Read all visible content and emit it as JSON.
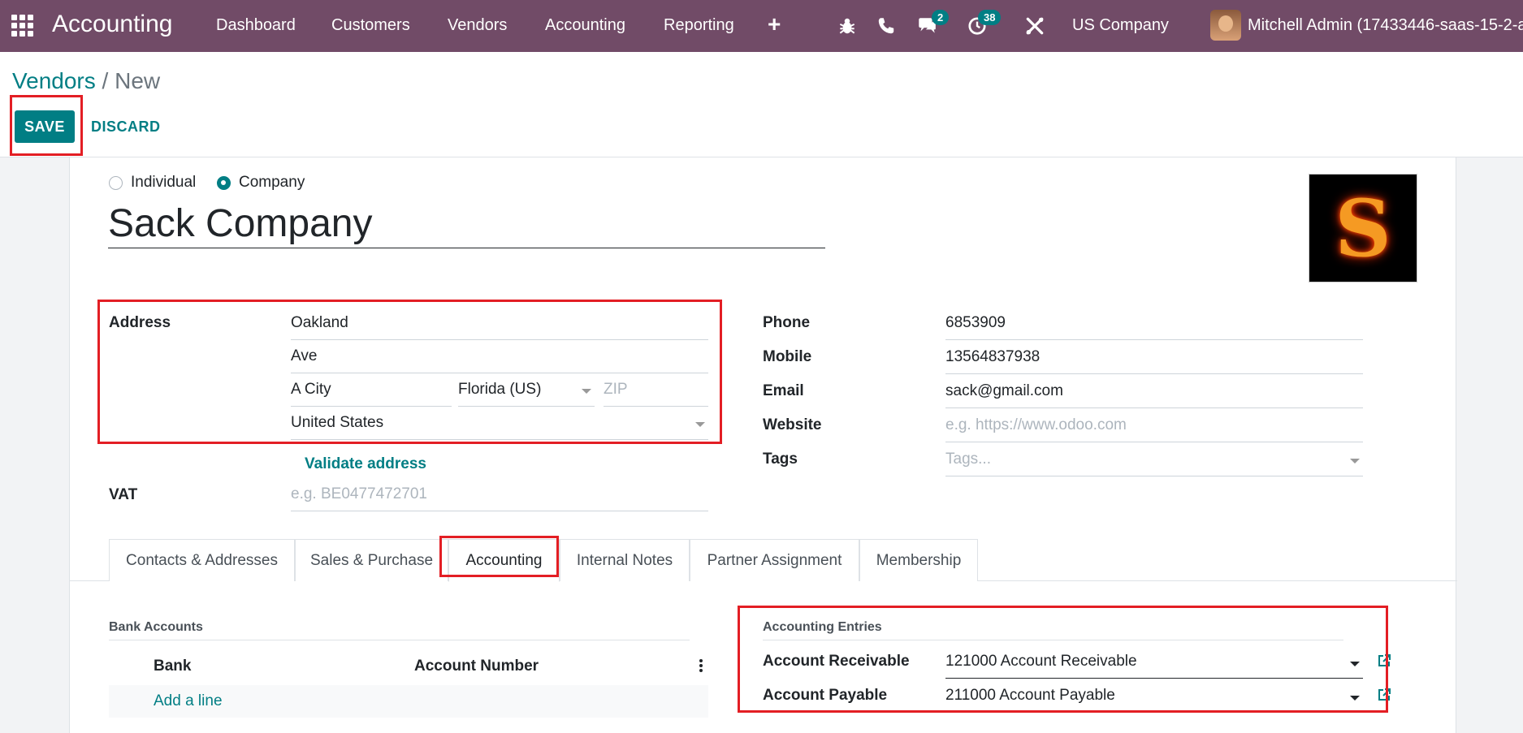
{
  "navbar": {
    "app_title": "Accounting",
    "menu": [
      "Dashboard",
      "Customers",
      "Vendors",
      "Accounting",
      "Reporting"
    ],
    "messages_count": "2",
    "activities_count": "38",
    "company": "US Company",
    "user": "Mitchell Admin (17433446-saas-15-2-al"
  },
  "breadcrumb": {
    "parent": "Vendors",
    "separator": "/",
    "current": "New"
  },
  "buttons": {
    "save": "SAVE",
    "discard": "DISCARD"
  },
  "form": {
    "type_options": [
      {
        "label": "Individual",
        "selected": false
      },
      {
        "label": "Company",
        "selected": true
      }
    ],
    "name": "Sack Company",
    "logo_letter": "S",
    "address": {
      "label": "Address",
      "street": "Oakland",
      "street2": "Ave",
      "city": "A City",
      "state": "Florida (US)",
      "zip_placeholder": "ZIP",
      "country": "United States",
      "validate_link": "Validate address"
    },
    "vat": {
      "label": "VAT",
      "placeholder": "e.g. BE0477472701"
    },
    "phone": {
      "label": "Phone",
      "value": "6853909"
    },
    "mobile": {
      "label": "Mobile",
      "value": "13564837938"
    },
    "email": {
      "label": "Email",
      "value": "sack@gmail.com"
    },
    "website": {
      "label": "Website",
      "placeholder": "e.g. https://www.odoo.com"
    },
    "tags": {
      "label": "Tags",
      "placeholder": "Tags..."
    }
  },
  "tabs": [
    {
      "label": "Contacts & Addresses",
      "active": false
    },
    {
      "label": "Sales & Purchase",
      "active": false
    },
    {
      "label": "Accounting",
      "active": true
    },
    {
      "label": "Internal Notes",
      "active": false
    },
    {
      "label": "Partner Assignment",
      "active": false
    },
    {
      "label": "Membership",
      "active": false
    }
  ],
  "accounting_tab": {
    "bank_accounts": {
      "title": "Bank Accounts",
      "columns": [
        "Bank",
        "Account Number"
      ],
      "add_line": "Add a line"
    },
    "entries": {
      "title": "Accounting Entries",
      "receivable_label": "Account Receivable",
      "receivable_value": "121000 Account Receivable",
      "payable_label": "Account Payable",
      "payable_value": "211000 Account Payable"
    }
  },
  "colors": {
    "navbar": "#714b67",
    "primary": "#017e84",
    "highlight": "#e31e24"
  }
}
